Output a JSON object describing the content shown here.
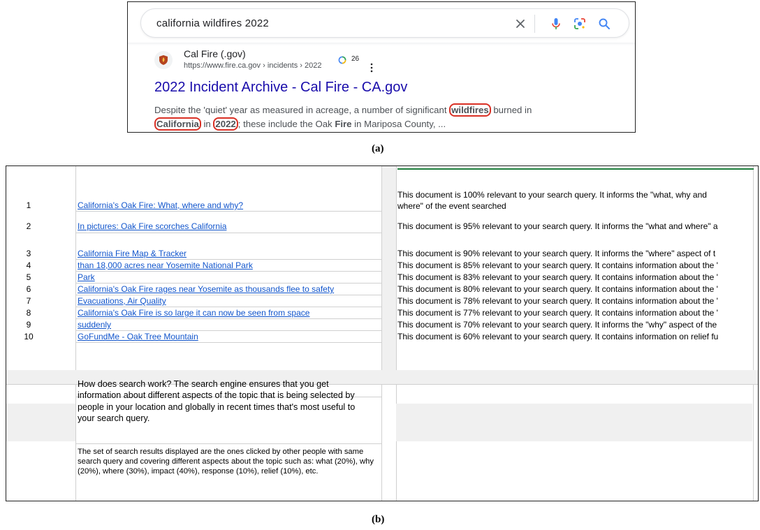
{
  "search": {
    "query": "california wildfires 2022",
    "result": {
      "site_name": "Cal Fire (.gov)",
      "url": "https://www.fire.ca.gov › incidents › 2022",
      "ring_count": "26",
      "title": "2022 Incident Archive - Cal Fire - CA.gov",
      "snippet": {
        "s1": "Despite the 'quiet' year as measured in acreage, a number of significant ",
        "k1": "wildfires",
        "s2": " burned in",
        "k2": "California",
        "s3": " in ",
        "k3": "2022",
        "s4": "; these include the Oak ",
        "k4": "Fire",
        "s5": " in Mariposa County, ..."
      }
    }
  },
  "captions": {
    "a": "(a)",
    "b": "(b)"
  },
  "sheet": {
    "rows": [
      {
        "num": "1",
        "link": "California's Oak Fire: What, where and why?",
        "desc_line1": "This document is 100% relevant to your search query. It informs the \"what, why and",
        "desc_line2": "where\" of the event searched"
      },
      {
        "num": "2",
        "link": "In pictures: Oak Fire scorches California",
        "desc": "This document is 95% relevant to your search query. It informs the \"what and where\" a"
      },
      {
        "num": "3",
        "link": "California Fire Map & Tracker",
        "desc": "This document is 90% relevant to your search query. It informs the \"where\" aspect of t"
      },
      {
        "num": "4",
        "link": "than 18,000 acres near Yosemite National Park",
        "desc": "This document is 85% relevant to your search query. It contains information about the '"
      },
      {
        "num": "5",
        "link": "Park",
        "desc": "This document is 83% relevant to your search query. It contains information about the '"
      },
      {
        "num": "6",
        "link": "California's Oak Fire rages near Yosemite as thousands flee to safety",
        "desc": "This document is 80% relevant to your search query. It contains information about the '"
      },
      {
        "num": "7",
        "link": "Evacuations, Air Quality",
        "desc": "This document is 78% relevant to your search query. It contains information about the '"
      },
      {
        "num": "8",
        "link": "California's Oak Fire is so large it can now be seen from space",
        "desc": "This document is 77% relevant to your search query. It contains information about the '"
      },
      {
        "num": "9",
        "link": "suddenly",
        "desc": "This document is 70% relevant to your search query. It informs the \"why\" aspect of the"
      },
      {
        "num": "10",
        "link": "GoFundMe - Oak Tree Mountain",
        "desc": "This document is 60% relevant to your search query. It contains information on relief fu"
      }
    ],
    "explain1": "How does search work? The search engine ensures that you get information about different aspects of the topic that is being selected by people in your location and globally in recent times that's most useful to your search query.",
    "explain2": "The set of search results displayed are the ones clicked by other people with same search query and covering different aspects about the topic such as: what (20%), why (20%), where (30%), impact (40%), response (10%), relief (10%), etc."
  }
}
